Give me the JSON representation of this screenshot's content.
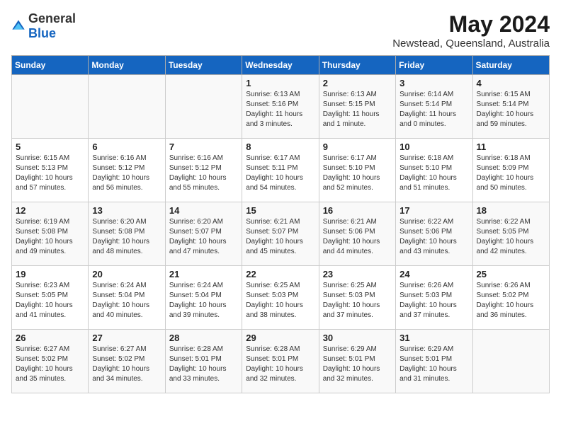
{
  "header": {
    "logo_general": "General",
    "logo_blue": "Blue",
    "month": "May 2024",
    "location": "Newstead, Queensland, Australia"
  },
  "weekdays": [
    "Sunday",
    "Monday",
    "Tuesday",
    "Wednesday",
    "Thursday",
    "Friday",
    "Saturday"
  ],
  "weeks": [
    [
      {
        "day": "",
        "info": ""
      },
      {
        "day": "",
        "info": ""
      },
      {
        "day": "",
        "info": ""
      },
      {
        "day": "1",
        "info": "Sunrise: 6:13 AM\nSunset: 5:16 PM\nDaylight: 11 hours and 3 minutes."
      },
      {
        "day": "2",
        "info": "Sunrise: 6:13 AM\nSunset: 5:15 PM\nDaylight: 11 hours and 1 minute."
      },
      {
        "day": "3",
        "info": "Sunrise: 6:14 AM\nSunset: 5:14 PM\nDaylight: 11 hours and 0 minutes."
      },
      {
        "day": "4",
        "info": "Sunrise: 6:15 AM\nSunset: 5:14 PM\nDaylight: 10 hours and 59 minutes."
      }
    ],
    [
      {
        "day": "5",
        "info": "Sunrise: 6:15 AM\nSunset: 5:13 PM\nDaylight: 10 hours and 57 minutes."
      },
      {
        "day": "6",
        "info": "Sunrise: 6:16 AM\nSunset: 5:12 PM\nDaylight: 10 hours and 56 minutes."
      },
      {
        "day": "7",
        "info": "Sunrise: 6:16 AM\nSunset: 5:12 PM\nDaylight: 10 hours and 55 minutes."
      },
      {
        "day": "8",
        "info": "Sunrise: 6:17 AM\nSunset: 5:11 PM\nDaylight: 10 hours and 54 minutes."
      },
      {
        "day": "9",
        "info": "Sunrise: 6:17 AM\nSunset: 5:10 PM\nDaylight: 10 hours and 52 minutes."
      },
      {
        "day": "10",
        "info": "Sunrise: 6:18 AM\nSunset: 5:10 PM\nDaylight: 10 hours and 51 minutes."
      },
      {
        "day": "11",
        "info": "Sunrise: 6:18 AM\nSunset: 5:09 PM\nDaylight: 10 hours and 50 minutes."
      }
    ],
    [
      {
        "day": "12",
        "info": "Sunrise: 6:19 AM\nSunset: 5:08 PM\nDaylight: 10 hours and 49 minutes."
      },
      {
        "day": "13",
        "info": "Sunrise: 6:20 AM\nSunset: 5:08 PM\nDaylight: 10 hours and 48 minutes."
      },
      {
        "day": "14",
        "info": "Sunrise: 6:20 AM\nSunset: 5:07 PM\nDaylight: 10 hours and 47 minutes."
      },
      {
        "day": "15",
        "info": "Sunrise: 6:21 AM\nSunset: 5:07 PM\nDaylight: 10 hours and 45 minutes."
      },
      {
        "day": "16",
        "info": "Sunrise: 6:21 AM\nSunset: 5:06 PM\nDaylight: 10 hours and 44 minutes."
      },
      {
        "day": "17",
        "info": "Sunrise: 6:22 AM\nSunset: 5:06 PM\nDaylight: 10 hours and 43 minutes."
      },
      {
        "day": "18",
        "info": "Sunrise: 6:22 AM\nSunset: 5:05 PM\nDaylight: 10 hours and 42 minutes."
      }
    ],
    [
      {
        "day": "19",
        "info": "Sunrise: 6:23 AM\nSunset: 5:05 PM\nDaylight: 10 hours and 41 minutes."
      },
      {
        "day": "20",
        "info": "Sunrise: 6:24 AM\nSunset: 5:04 PM\nDaylight: 10 hours and 40 minutes."
      },
      {
        "day": "21",
        "info": "Sunrise: 6:24 AM\nSunset: 5:04 PM\nDaylight: 10 hours and 39 minutes."
      },
      {
        "day": "22",
        "info": "Sunrise: 6:25 AM\nSunset: 5:03 PM\nDaylight: 10 hours and 38 minutes."
      },
      {
        "day": "23",
        "info": "Sunrise: 6:25 AM\nSunset: 5:03 PM\nDaylight: 10 hours and 37 minutes."
      },
      {
        "day": "24",
        "info": "Sunrise: 6:26 AM\nSunset: 5:03 PM\nDaylight: 10 hours and 37 minutes."
      },
      {
        "day": "25",
        "info": "Sunrise: 6:26 AM\nSunset: 5:02 PM\nDaylight: 10 hours and 36 minutes."
      }
    ],
    [
      {
        "day": "26",
        "info": "Sunrise: 6:27 AM\nSunset: 5:02 PM\nDaylight: 10 hours and 35 minutes."
      },
      {
        "day": "27",
        "info": "Sunrise: 6:27 AM\nSunset: 5:02 PM\nDaylight: 10 hours and 34 minutes."
      },
      {
        "day": "28",
        "info": "Sunrise: 6:28 AM\nSunset: 5:01 PM\nDaylight: 10 hours and 33 minutes."
      },
      {
        "day": "29",
        "info": "Sunrise: 6:28 AM\nSunset: 5:01 PM\nDaylight: 10 hours and 32 minutes."
      },
      {
        "day": "30",
        "info": "Sunrise: 6:29 AM\nSunset: 5:01 PM\nDaylight: 10 hours and 32 minutes."
      },
      {
        "day": "31",
        "info": "Sunrise: 6:29 AM\nSunset: 5:01 PM\nDaylight: 10 hours and 31 minutes."
      },
      {
        "day": "",
        "info": ""
      }
    ]
  ]
}
